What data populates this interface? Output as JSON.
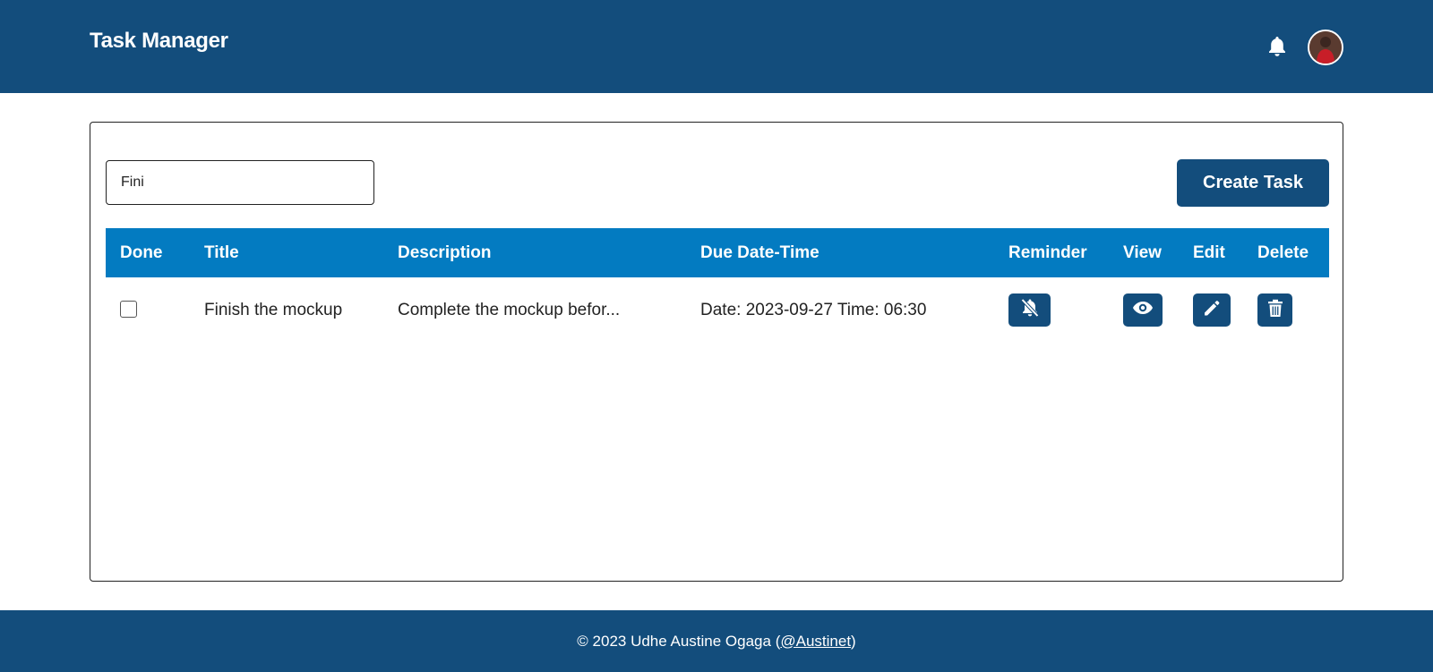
{
  "header": {
    "title": "Task Manager",
    "notification_icon": "bell-icon",
    "avatar_icon": "user-avatar"
  },
  "toolbar": {
    "search_value": "Fini",
    "create_label": "Create Task"
  },
  "table": {
    "columns": [
      "Done",
      "Title",
      "Description",
      "Due Date-Time",
      "Reminder",
      "View",
      "Edit",
      "Delete"
    ],
    "rows": [
      {
        "done": false,
        "title": "Finish the mockup",
        "description": "Complete the mockup befor...",
        "due": "Date: 2023-09-27 Time: 06:30",
        "reminder_icon": "bell-slash-icon",
        "view_icon": "eye-icon",
        "edit_icon": "pencil-icon",
        "delete_icon": "trash-icon"
      }
    ]
  },
  "footer": {
    "prefix": "© 2023 Udhe Austine Ogaga (",
    "handle": "@Austinet",
    "suffix": ")"
  },
  "colors": {
    "navy": "#134d7c",
    "header_blue": "#037bc1"
  }
}
